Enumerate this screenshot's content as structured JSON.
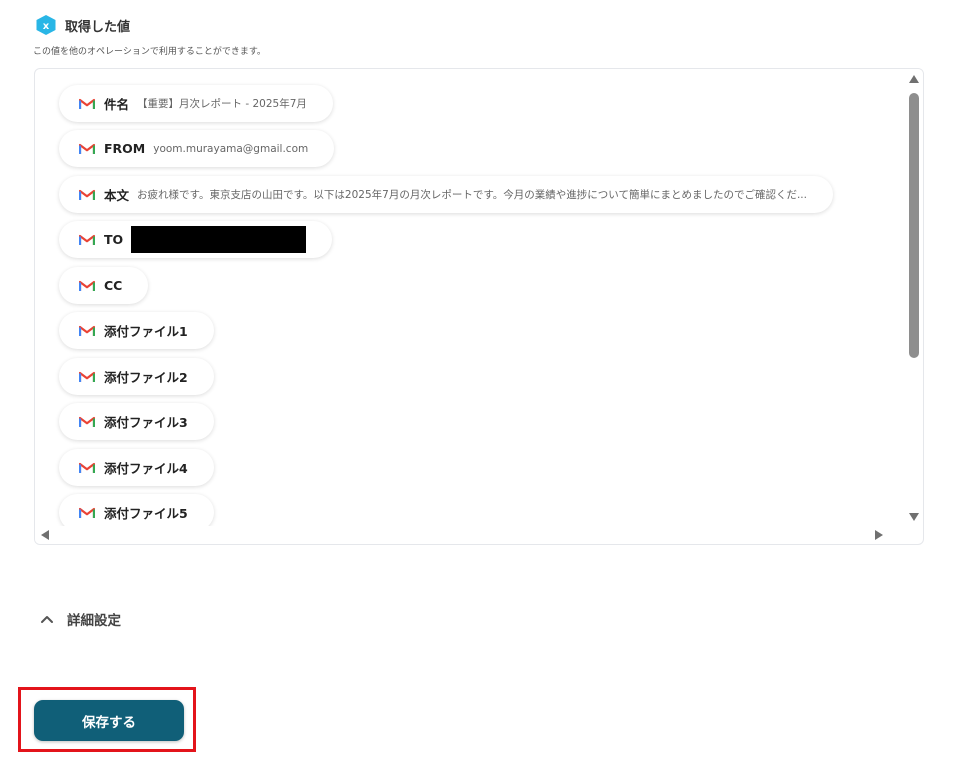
{
  "section": {
    "title": "取得した値",
    "description": "この値を他のオペレーションで利用することができます。",
    "badge_icon": "x-variable-icon",
    "accent_color": "#29b6e6"
  },
  "values": [
    {
      "label": "件名",
      "value": "【重要】月次レポート - 2025年7月",
      "icon": "gmail-icon"
    },
    {
      "label": "FROM",
      "value": "yoom.murayama@gmail.com",
      "icon": "gmail-icon"
    },
    {
      "label": "本文",
      "value": "お疲れ様です。東京支店の山田です。以下は2025年7月の月次レポートです。今月の業績や進捗について簡単にまとめましたのでご確認くだ...",
      "icon": "gmail-icon"
    },
    {
      "label": "TO",
      "value": "",
      "redacted": true,
      "icon": "gmail-icon"
    },
    {
      "label": "CC",
      "value": "",
      "icon": "gmail-icon"
    },
    {
      "label": "添付ファイル1",
      "value": "",
      "icon": "gmail-icon"
    },
    {
      "label": "添付ファイル2",
      "value": "",
      "icon": "gmail-icon"
    },
    {
      "label": "添付ファイル3",
      "value": "",
      "icon": "gmail-icon"
    },
    {
      "label": "添付ファイル4",
      "value": "",
      "icon": "gmail-icon"
    },
    {
      "label": "添付ファイル5",
      "value": "",
      "icon": "gmail-icon"
    }
  ],
  "details": {
    "label": "詳細設定",
    "icon": "chevron-up-icon"
  },
  "save": {
    "label": "保存する",
    "color": "#105f78",
    "highlight_color": "#e3141b"
  }
}
